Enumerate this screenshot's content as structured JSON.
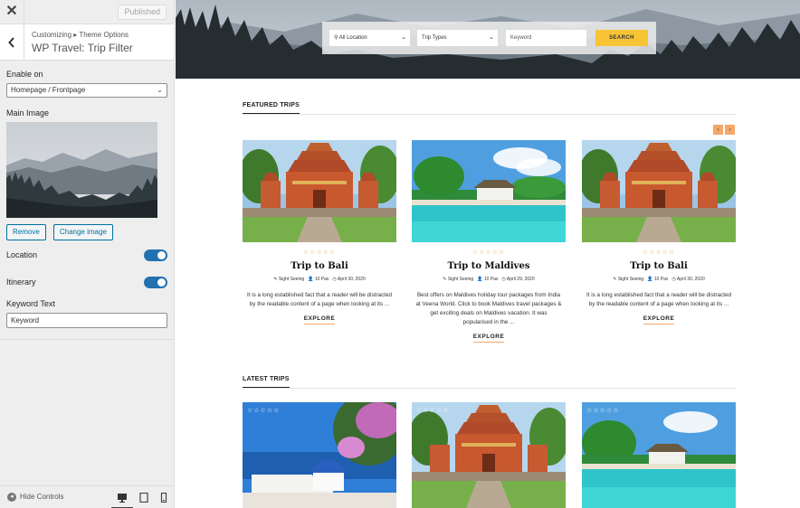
{
  "customizer": {
    "close_label": "✕",
    "published_label": "Published",
    "breadcrumb": "Customizing ▸ Theme Options",
    "section_title": "WP Travel: Trip Filter",
    "enable_on_label": "Enable on",
    "enable_on_value": "Homepage / Frontpage",
    "main_image_label": "Main Image",
    "remove_label": "Remove",
    "change_image_label": "Change image",
    "location_label": "Location",
    "location_on": true,
    "itinerary_label": "Itinerary",
    "itinerary_on": true,
    "keyword_text_label": "Keyword Text",
    "keyword_text_value": "Keyword",
    "hide_controls_label": "Hide Controls",
    "accent": "#2271b1"
  },
  "preview": {
    "search": {
      "location": "All Location",
      "trip_types": "Trip Types",
      "keyword_placeholder": "Keyword",
      "search_label": "SEARCH",
      "button_color": "#f7c436"
    },
    "featured_title": "FEATURED TRIPS",
    "latest_title": "LATEST TRIPS",
    "prev_label": "‹",
    "next_label": "›",
    "stars": "☆☆☆☆☆",
    "featured": [
      {
        "title": "Trip to Bali",
        "category": "Sight Seeing",
        "pax": "10 Pax",
        "date": "April 30, 2020",
        "desc": "It is a long established fact that a reader will be distracted by the readable content of a page when looking at its ...",
        "cta": "EXPLORE"
      },
      {
        "title": "Trip to Maldives",
        "category": "Sight Seeing",
        "pax": "10 Pax",
        "date": "April 29, 2020",
        "desc": "Best offers on Maldives holiday tour packages from India at Veena World. Click to book Maldives travel packages & get exciting deals on Maldives vacation.  It was popularised in the ...",
        "cta": "EXPLORE"
      },
      {
        "title": "Trip to Bali",
        "category": "Sight Seeing",
        "pax": "10 Pax",
        "date": "April 30, 2020",
        "desc": "It is a long established fact that a reader will be distracted by the readable content of a page when looking at its ...",
        "cta": "EXPLORE"
      }
    ]
  }
}
